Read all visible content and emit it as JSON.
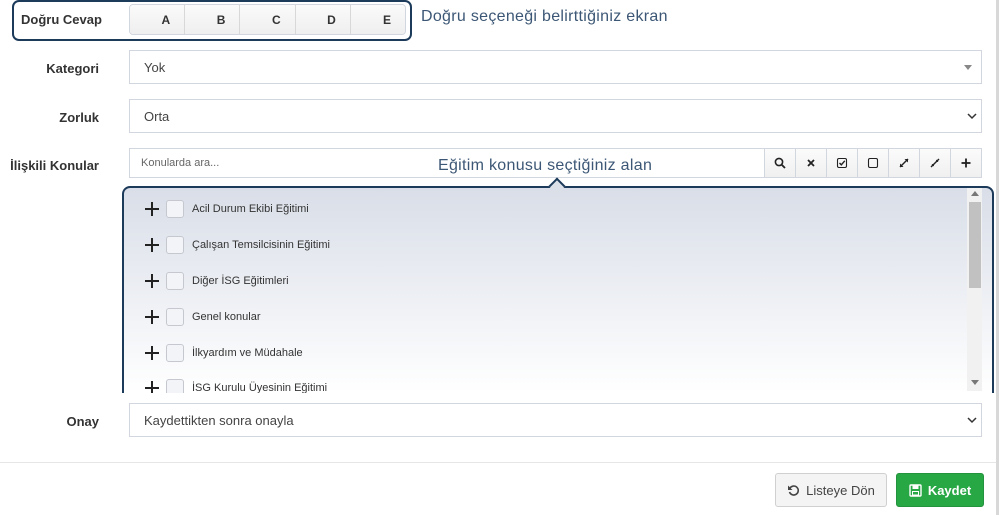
{
  "answer": {
    "label": "Doğru Cevap",
    "options": [
      "A",
      "B",
      "C",
      "D",
      "E"
    ],
    "annotation": "Doğru seçeneği belirttiğiniz ekran"
  },
  "category": {
    "label": "Kategori",
    "value": "Yok"
  },
  "difficulty": {
    "label": "Zorluk",
    "value": "Orta"
  },
  "topics": {
    "label": "İlişkili Konular",
    "search_placeholder": "Konularda ara...",
    "annotation": "Eğitim konusu seçtiğiniz alan",
    "tools": [
      "search-icon",
      "clear-icon",
      "check-all-icon",
      "uncheck-all-icon",
      "expand-icon",
      "collapse-icon",
      "add-icon"
    ],
    "items": [
      "Acil Durum Ekibi Eğitimi",
      "Çalışan Temsilcisinin Eğitimi",
      "Diğer İSG Eğitimleri",
      "Genel konular",
      "İlkyardım ve Müdahale",
      "İSG Kurulu Üyesinin Eğitimi"
    ]
  },
  "approval": {
    "label": "Onay",
    "value": "Kaydettikten sonra onayla"
  },
  "buttons": {
    "back": "Listeye Dön",
    "save": "Kaydet"
  },
  "colors": {
    "annotation_border": "#1c3a5a",
    "save_button": "#28a745"
  }
}
